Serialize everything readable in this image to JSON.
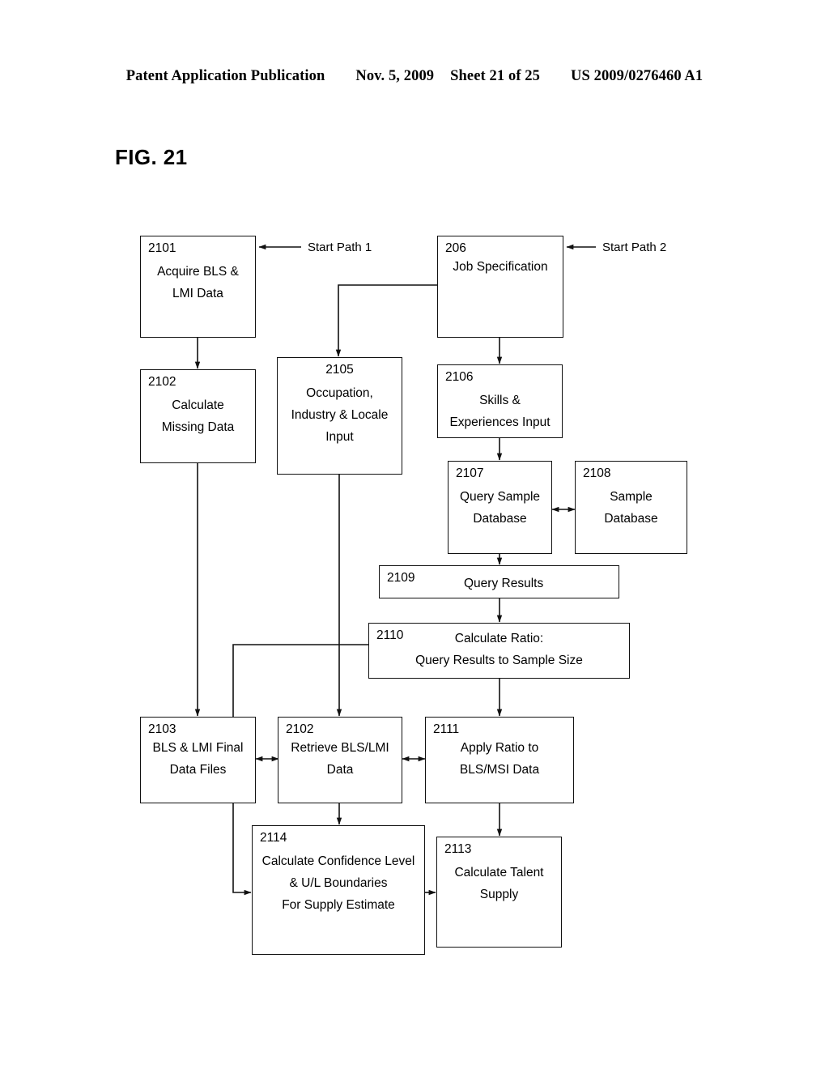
{
  "header": {
    "publication": "Patent Application Publication",
    "date": "Nov. 5, 2009",
    "sheet": "Sheet 21 of 25",
    "patent_number": "US 2009/0276460 A1"
  },
  "figure": {
    "label": "FIG. 21"
  },
  "annotations": {
    "start_path_1": "Start Path 1",
    "start_path_2": "Start Path 2"
  },
  "nodes": {
    "n2101": {
      "id": "2101",
      "lines": [
        "Acquire BLS &",
        "LMI Data"
      ]
    },
    "n206": {
      "id": "206",
      "lines": [
        "Job Specification"
      ]
    },
    "n2102a": {
      "id": "2102",
      "lines": [
        "Calculate",
        "Missing Data"
      ]
    },
    "n2105": {
      "id": "2105",
      "lines": [
        "Occupation,",
        "Industry & Locale",
        "Input"
      ]
    },
    "n2106": {
      "id": "2106",
      "lines": [
        "Skills &",
        "Experiences Input"
      ]
    },
    "n2107": {
      "id": "2107",
      "lines": [
        "Query Sample",
        "Database"
      ]
    },
    "n2108": {
      "id": "2108",
      "lines": [
        "Sample",
        "Database"
      ]
    },
    "n2109": {
      "id": "2109",
      "lines": [
        "Query Results"
      ]
    },
    "n2110": {
      "id": "2110",
      "lines": [
        "Calculate Ratio:",
        "Query Results to Sample Size"
      ]
    },
    "n2103": {
      "id": "2103",
      "lines": [
        "BLS & LMI Final",
        "Data Files"
      ]
    },
    "n2102b": {
      "id": "2102",
      "lines": [
        "Retrieve BLS/LMI",
        "Data"
      ]
    },
    "n2111": {
      "id": "2111",
      "lines": [
        "Apply Ratio to",
        "BLS/MSI Data"
      ]
    },
    "n2114": {
      "id": "2114",
      "lines": [
        "Calculate Confidence Level",
        "& U/L Boundaries",
        "For Supply Estimate"
      ]
    },
    "n2113": {
      "id": "2113",
      "lines": [
        "Calculate Talent",
        "Supply"
      ]
    }
  },
  "colors": {
    "stroke": "#111111",
    "background": "#ffffff"
  }
}
